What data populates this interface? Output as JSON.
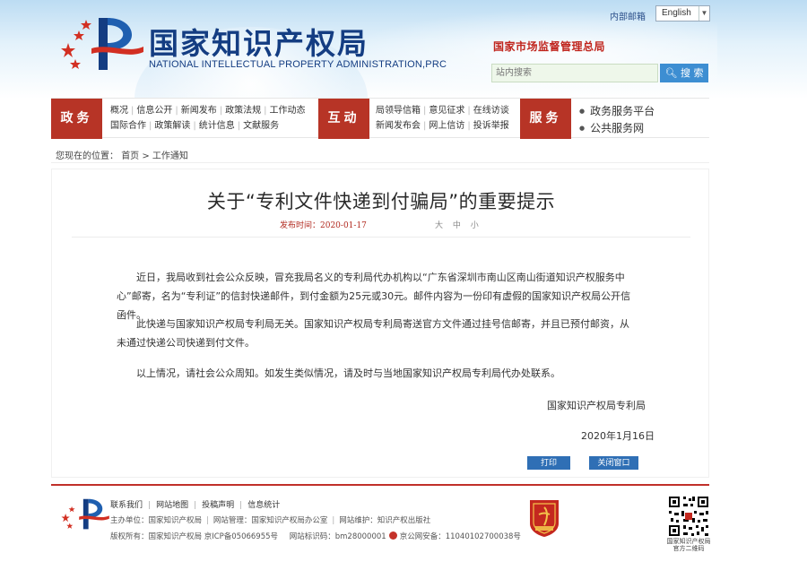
{
  "header": {
    "title_cn": "国家知识产权局",
    "title_en": "NATIONAL INTELLECTUAL PROPERTY ADMINISTRATION,PRC",
    "intranet_link": "内部邮箱",
    "language": "English",
    "samr_link": "国家市场监督管理总局",
    "search_placeholder": "站内搜索",
    "search_button": "搜 索"
  },
  "nav": {
    "tab_gov": "政务",
    "gov_links_row1": [
      "概况",
      "信息公开",
      "新闻发布",
      "政策法规",
      "工作动态"
    ],
    "gov_links_row2": [
      "国际合作",
      "政策解读",
      "统计信息",
      "文献服务"
    ],
    "tab_interact": "互动",
    "interact_links_row1": [
      "局领导信箱",
      "意见征求",
      "在线访谈"
    ],
    "interact_links_row2": [
      "新闻发布会",
      "网上信访",
      "投诉举报"
    ],
    "tab_service": "服务",
    "service_links": [
      "政务服务平台",
      "公共服务网"
    ]
  },
  "breadcrumb": {
    "label": "您现在的位置：",
    "path": "首页 > 工作通知"
  },
  "article": {
    "title": "关于“专利文件快递到付骗局”的重要提示",
    "meta": "发布时间：2020-01-17",
    "font_size": "大 中 小",
    "p1": "近日，我局收到社会公众反映，冒充我局名义的专利局代办机构以“广东省深圳市南山区南山街道知识产权服务中心”邮寄，名为“专利证”的信封快递邮件，到付金额为25元或30元。邮件内容为一份印有虚假的国家知识产权局公开信函件。",
    "p2": "此快递与国家知识产权局专利局无关。国家知识产权局专利局寄送官方文件通过挂号信邮寄，并且已预付邮资，从未通过快递公司快递到付文件。",
    "p3": "以上情况，请社会公众周知。如发生类似情况，请及时与当地国家知识产权局专利局代办处联系。",
    "signature": "国家知识产权局专利局",
    "date": "2020年1月16日",
    "print_button": "打印",
    "close_button": "关闭窗口"
  },
  "footer": {
    "links": [
      "联系我们",
      "网站地图",
      "投稿声明",
      "信息统计"
    ],
    "host_label": "主办单位：国家知识产权局",
    "maintainer_label": "网站管理：国家知识产权局办公室",
    "support_label": "网站维护：知识产权出版社",
    "copyright": "版权所有：国家知识产权局 京ICP备05066955号",
    "site_id": "网站标识码：bm28000001",
    "police_record": "京公网安备：11040102700038号",
    "qr_caption": "国家知识产权局 官方二维码"
  },
  "colors": {
    "brand_red": "#b73426",
    "brand_blue": "#143d82",
    "accent_blue": "#3d8ed2"
  }
}
